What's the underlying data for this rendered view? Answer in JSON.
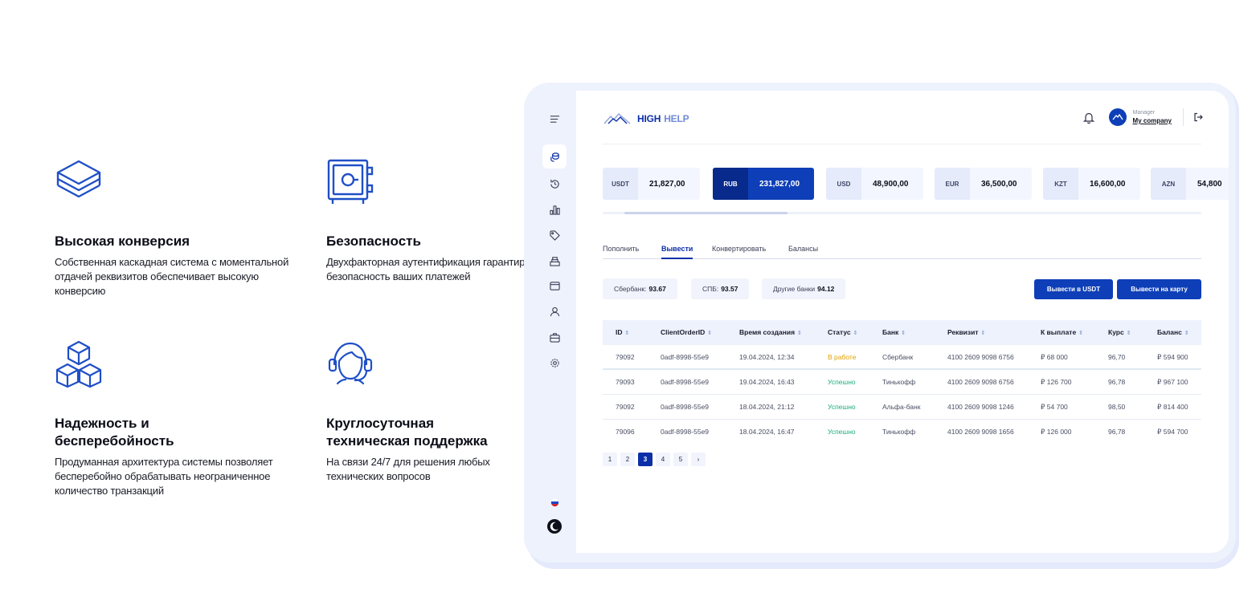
{
  "features": [
    {
      "icon": "layers-icon",
      "title": "Высокая конверсия",
      "text": "Собственная каскадная система с моментальной отдачей реквизитов обеспечивает высокую конверсию"
    },
    {
      "icon": "safe-icon",
      "title": "Безопасность",
      "text": "Двухфакторная аутентификация гарантирует безопасность ваших платежей"
    },
    {
      "icon": "cubes-icon",
      "title": "Надежность и бесперебойность",
      "text": "Продуманная архитектура системы позволяет бесперебойно обрабатывать неограниченное количество транзакций"
    },
    {
      "icon": "support-headset-icon",
      "title": "Круглосуточная техническая поддержка",
      "text": "На связи 24/7 для решения любых технических вопросов"
    }
  ],
  "dashboard": {
    "logo": {
      "word1": "HIGH",
      "word2": "HELP"
    },
    "user": {
      "role": "Manager",
      "company": "My company"
    },
    "currencies": [
      {
        "code": "USDT",
        "amount": "21,827,00",
        "active": false
      },
      {
        "code": "RUB",
        "amount": "231,827,00",
        "active": true
      },
      {
        "code": "USD",
        "amount": "48,900,00",
        "active": false
      },
      {
        "code": "EUR",
        "amount": "36,500,00",
        "active": false
      },
      {
        "code": "KZT",
        "amount": "16,600,00",
        "active": false
      },
      {
        "code": "AZN",
        "amount": "54,800",
        "active": false
      }
    ],
    "tabs": [
      "Пополнить",
      "Вывести",
      "Конвертировать",
      "Балансы"
    ],
    "active_tab": "Вывести",
    "rates": [
      {
        "label": "Сбербанк:",
        "value": "93.67"
      },
      {
        "label": "СПБ:",
        "value": "93.57"
      },
      {
        "label": "Другие банки",
        "value": "94.12"
      }
    ],
    "buttons": {
      "withdraw_usdt": "Вывести в USDT",
      "withdraw_card": "Вывести на карту"
    },
    "table": {
      "columns": [
        "ID",
        "ClientOrderID",
        "Время создания",
        "Статус",
        "Банк",
        "Реквизит",
        "К выплате",
        "Курс",
        "Баланс"
      ],
      "rows": [
        [
          "79092",
          "0adf-8998-55e9",
          "19.04.2024, 12:34",
          "В работе",
          "Сбербанк",
          "4100 2609 9098 6756",
          "₽ 68 000",
          "96,70",
          "₽ 594 900"
        ],
        [
          "79093",
          "0adf-8998-55e9",
          "19.04.2024, 16:43",
          "Успешно",
          "Тинькофф",
          "4100 2609 9098 6756",
          "₽ 126 700",
          "96,78",
          "₽ 967 100"
        ],
        [
          "79092",
          "0adf-8998-55e9",
          "18.04.2024, 21:12",
          "Успешно",
          "Альфа-банк",
          "4100 2609 9098 1246",
          "₽ 54 700",
          "98,50",
          "₽ 814 400"
        ],
        [
          "79096",
          "0adf-8998-55e9",
          "18.04.2024, 16:47",
          "Успешно",
          "Тинькофф",
          "4100 2609 9098 1656",
          "₽ 126 000",
          "96,78",
          "₽ 594 700"
        ]
      ]
    },
    "pagination": {
      "pages": [
        "1",
        "2",
        "3",
        "4",
        "5"
      ],
      "current": "3",
      "next": "›"
    },
    "sidebar_icons": [
      "menu-icon",
      "coins-icon",
      "history-icon",
      "chart-icon",
      "tag-icon",
      "stack-icon",
      "wallet-icon",
      "user-icon",
      "briefcase-icon",
      "settings-icon"
    ],
    "colors": {
      "accent": "#0e3fb8",
      "status_in_progress": "#e1a100",
      "status_success": "#1fae7a",
      "frame": "#eef2fd"
    }
  }
}
